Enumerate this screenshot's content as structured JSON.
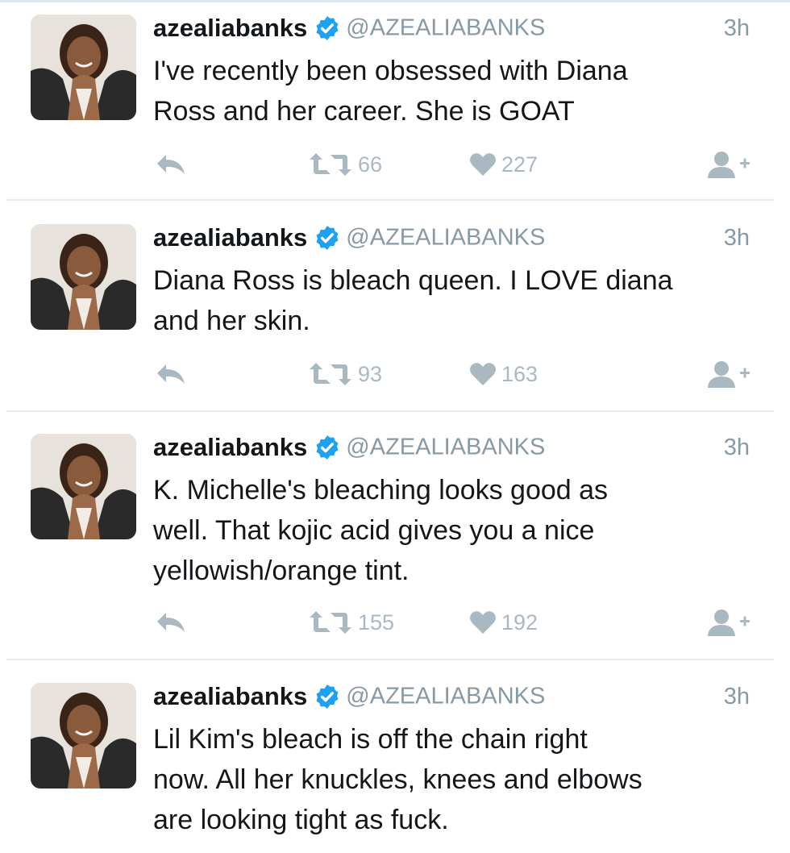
{
  "tweets": [
    {
      "username": "azealiabanks",
      "handle": "@AZEALIABANKS",
      "time": "3h",
      "lines": [
        "I've recently been obsessed with Diana",
        "Ross and her career. She is GOAT"
      ],
      "retweets": "66",
      "likes": "227"
    },
    {
      "username": "azealiabanks",
      "handle": "@AZEALIABANKS",
      "time": "3h",
      "lines": [
        "Diana Ross is bleach queen. I LOVE diana",
        "and her skin."
      ],
      "retweets": "93",
      "likes": "163"
    },
    {
      "username": "azealiabanks",
      "handle": "@AZEALIABANKS",
      "time": "3h",
      "lines": [
        "K. Michelle's bleaching looks good as",
        "well. That kojic acid gives you a nice",
        "yellowish/orange tint."
      ],
      "retweets": "155",
      "likes": "192"
    },
    {
      "username": "azealiabanks",
      "handle": "@AZEALIABANKS",
      "time": "3h",
      "lines": [
        "Lil Kim's bleach is off the chain right",
        "now. All her knuckles, knees and elbows",
        "are looking tight as fuck."
      ]
    }
  ],
  "icons": {
    "verified": "verified-badge-icon",
    "reply": "reply-icon",
    "retweet": "retweet-icon",
    "like": "heart-icon",
    "follow": "follow-user-icon"
  },
  "colors": {
    "verified_blue": "#1da1f2",
    "action_gray": "#aab8c2",
    "handle_gray": "#8899a6",
    "divider": "#e6ecf0"
  }
}
